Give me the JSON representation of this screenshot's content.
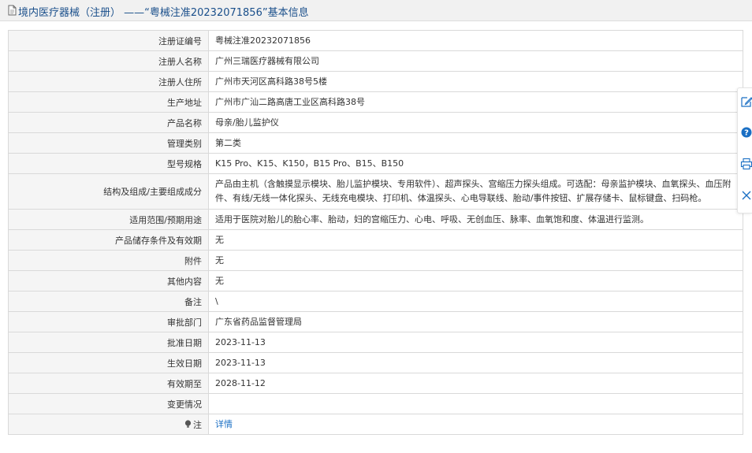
{
  "header": {
    "title": "境内医疗器械（注册） ——“粤械注准20232071856”基本信息"
  },
  "fields": [
    {
      "label": "注册证编号",
      "value": "粤械注准20232071856"
    },
    {
      "label": "注册人名称",
      "value": "广州三瑞医疗器械有限公司"
    },
    {
      "label": "注册人住所",
      "value": "广州市天河区高科路38号5楼"
    },
    {
      "label": "生产地址",
      "value": "广州市广汕二路高唐工业区高科路38号"
    },
    {
      "label": "产品名称",
      "value": "母亲/胎儿监护仪"
    },
    {
      "label": "管理类别",
      "value": "第二类"
    },
    {
      "label": "型号规格",
      "value": "K15 Pro、K15、K150，B15 Pro、B15、B150"
    },
    {
      "label": "结构及组成/主要组成成分",
      "value": "产品由主机（含触摸显示模块、胎儿监护模块、专用软件）、超声探头、宫缩压力探头组成。可选配：母亲监护模块、血氧探头、血压附件、有线/无线一体化探头、无线充电模块、打印机、体温探头、心电导联线、胎动/事件按钮、扩展存储卡、鼠标键盘、扫码枪。"
    },
    {
      "label": "适用范围/预期用途",
      "value": "适用于医院对胎儿的胎心率、胎动，妇的宫缩压力、心电、呼吸、无创血压、脉率、血氧饱和度、体温进行监测。"
    },
    {
      "label": "产品储存条件及有效期",
      "value": "无"
    },
    {
      "label": "附件",
      "value": "无"
    },
    {
      "label": "其他内容",
      "value": "无"
    },
    {
      "label": "备注",
      "value": "\\"
    },
    {
      "label": "审批部门",
      "value": "广东省药品监督管理局"
    },
    {
      "label": "批准日期",
      "value": "2023-11-13"
    },
    {
      "label": "生效日期",
      "value": "2023-11-13"
    },
    {
      "label": "有效期至",
      "value": "2028-11-12"
    },
    {
      "label": "变更情况",
      "value": ""
    }
  ],
  "note": {
    "label": "注",
    "link_text": "详情"
  },
  "side_tools": [
    "edit-icon",
    "help-icon",
    "print-icon",
    "close-icon"
  ],
  "colors": {
    "title": "#1a4f8b",
    "link": "#1a6fc4",
    "label_bg": "#f5f5f5",
    "border": "#d9d9d9"
  }
}
